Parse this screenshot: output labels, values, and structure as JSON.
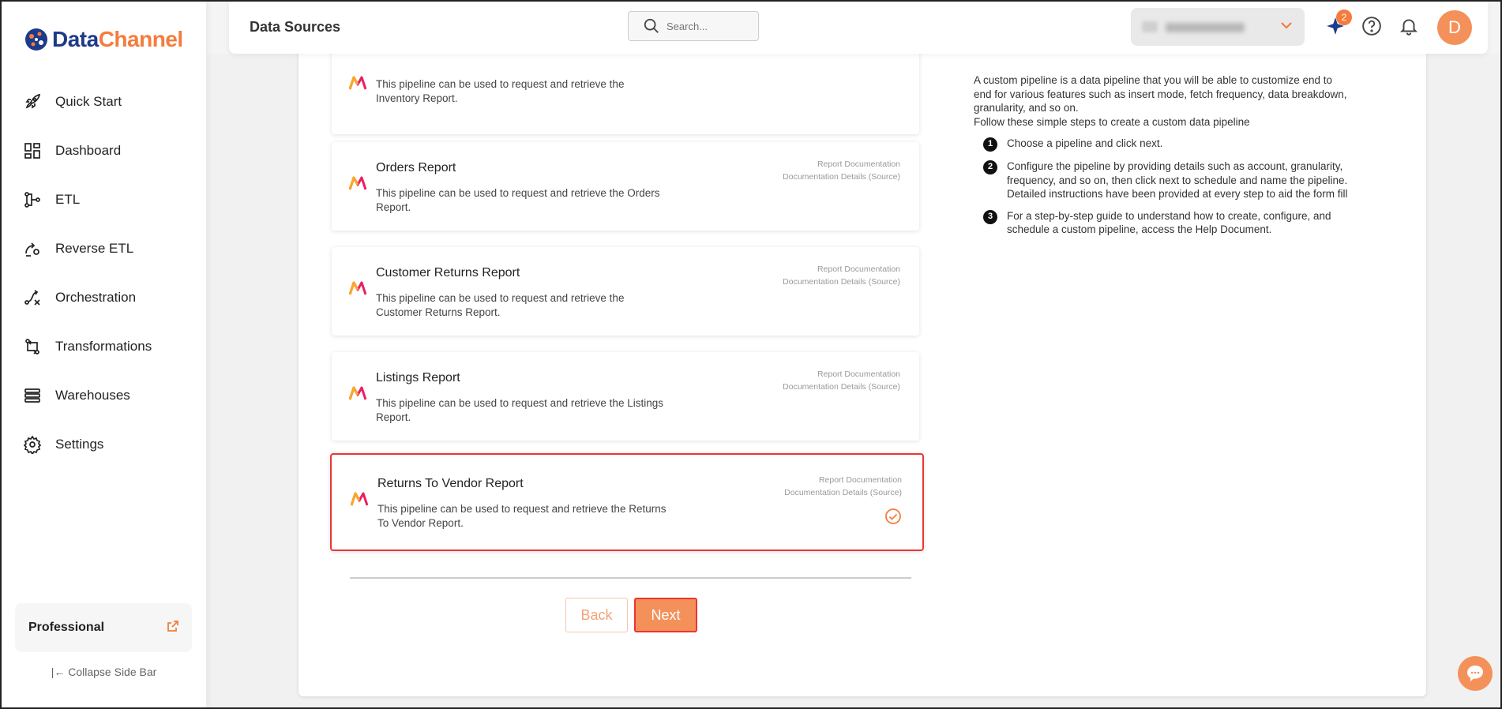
{
  "app": {
    "logo_data": "Data",
    "logo_channel": "Channel"
  },
  "sidebar": {
    "items": [
      {
        "label": "Quick Start",
        "icon": "rocket-icon"
      },
      {
        "label": "Dashboard",
        "icon": "dashboard-icon"
      },
      {
        "label": "ETL",
        "icon": "etl-icon"
      },
      {
        "label": "Reverse ETL",
        "icon": "reverse-etl-icon"
      },
      {
        "label": "Orchestration",
        "icon": "orchestration-icon"
      },
      {
        "label": "Transformations",
        "icon": "transformations-icon"
      },
      {
        "label": "Warehouses",
        "icon": "warehouses-icon"
      },
      {
        "label": "Settings",
        "icon": "gear-icon"
      }
    ],
    "plan": "Professional",
    "collapse": "Collapse Side Bar"
  },
  "header": {
    "title": "Data Sources",
    "search_placeholder": "Search...",
    "notification_count": "2",
    "avatar_letter": "D"
  },
  "cards": [
    {
      "title": "",
      "desc": "This pipeline can be used to request and retrieve the Inventory Report.",
      "link1": "",
      "link2": "",
      "selected": false
    },
    {
      "title": "Orders Report",
      "desc": "This pipeline can be used to request and retrieve the Orders Report.",
      "link1": "Report Documentation",
      "link2": "Documentation Details (Source)",
      "selected": false
    },
    {
      "title": "Customer Returns Report",
      "desc": "This pipeline can be used to request and retrieve the Customer Returns Report.",
      "link1": "Report Documentation",
      "link2": "Documentation Details (Source)",
      "selected": false
    },
    {
      "title": "Listings Report",
      "desc": "This pipeline can be used to request and retrieve the Listings Report.",
      "link1": "Report Documentation",
      "link2": "Documentation Details (Source)",
      "selected": false
    },
    {
      "title": "Returns To Vendor Report",
      "desc": "This pipeline can be used to request and retrieve the Returns To Vendor Report.",
      "link1": "Report Documentation",
      "link2": "Documentation Details (Source)",
      "selected": true
    }
  ],
  "buttons": {
    "back": "Back",
    "next": "Next"
  },
  "info": {
    "intro": "A custom pipeline is a data pipeline that you will be able to customize end to end for various features such as insert mode, fetch frequency, data breakdown, granularity, and so on.",
    "follow": "Follow these simple steps to create a custom data pipeline",
    "steps": [
      {
        "num": "1",
        "text": "Choose a pipeline and click next."
      },
      {
        "num": "2",
        "text": "Configure the pipeline by providing details such as account, granularity, frequency, and so on, then click next to schedule and name the pipeline. Detailed instructions have been provided at every step to aid the form fill"
      },
      {
        "num": "3",
        "text": "For a step-by-step guide to understand how to create, configure, and schedule a custom pipeline, access the Help Document."
      }
    ]
  },
  "colors": {
    "accent": "#f47c3c",
    "brand_navy": "#1e3a8a",
    "selection": "#e33333"
  }
}
